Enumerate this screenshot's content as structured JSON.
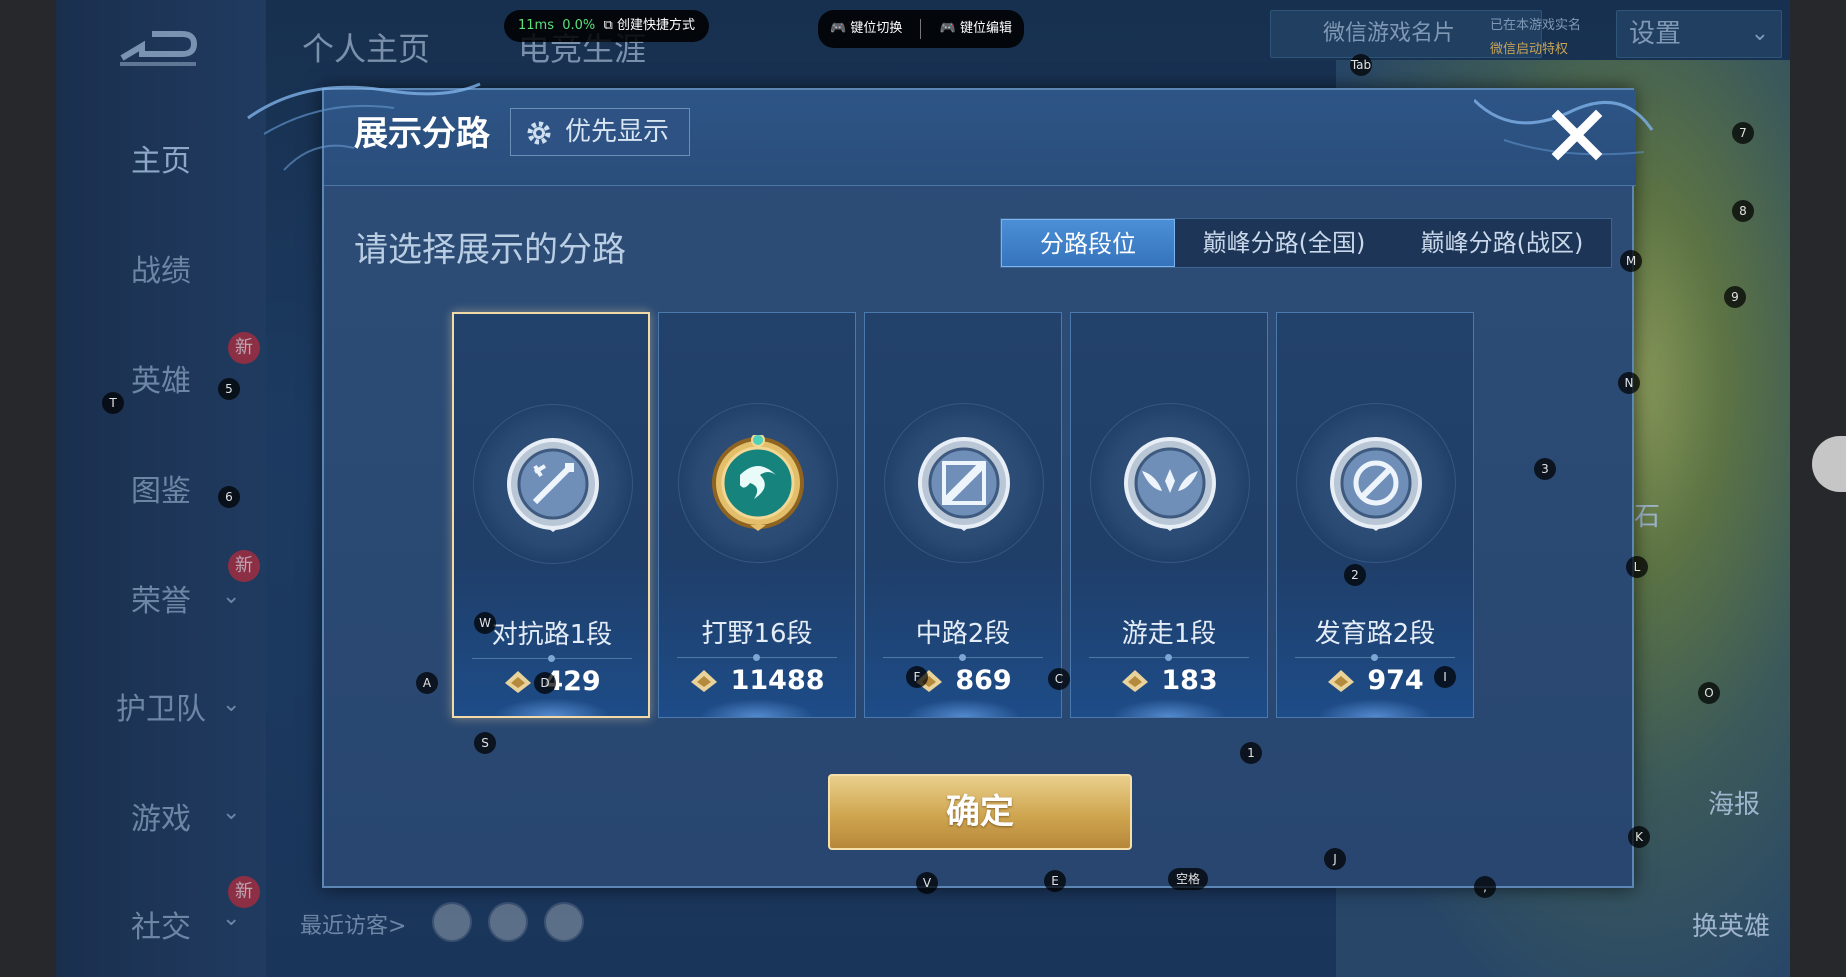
{
  "overlay": {
    "latency": "11ms",
    "loss": "0.0%",
    "create_shortcut": "创建快捷方式",
    "key_switch": "键位切换",
    "key_edit": "键位编辑",
    "keys": {
      "tab": "Tab",
      "n7": "7",
      "n8": "8",
      "m": "M",
      "n9": "9",
      "n": "N",
      "n3": "3",
      "l": "L",
      "o": "O",
      "k": "K",
      "j": "J",
      "comma": ",",
      "space": "空格",
      "e": "E",
      "v": "V",
      "s": "S",
      "n1": "1",
      "i": "I",
      "c": "C",
      "f": "F",
      "a": "A",
      "d": "D",
      "w": "W",
      "n2": "2",
      "n5": "5",
      "n6": "6",
      "t": "T"
    }
  },
  "background": {
    "tabs": [
      "个人主页",
      "电竞生涯"
    ],
    "sidebar": [
      "主页",
      "战绩",
      "英雄",
      "图鉴",
      "荣誉",
      "护卫队",
      "游戏",
      "社交"
    ],
    "new_badge": "新",
    "wechat_card": "微信游戏名片",
    "settings": "设置",
    "realname": "已在本游戏实名",
    "wechat_auth": "微信启动特权",
    "map_stone": "铭记之石",
    "poster": "海报",
    "switch_hero": "换英雄",
    "recent_visitors": "最近访客>"
  },
  "dialog": {
    "title": "展示分路",
    "priority_button": "优先显示",
    "subtitle": "请选择展示的分路",
    "tabs": [
      "分路段位",
      "巅峰分路(全国)",
      "巅峰分路(战区)"
    ],
    "active_tab": 0,
    "cards": [
      {
        "name": "对抗路1段",
        "score": "429",
        "selected": true,
        "emblem": "sword-emblem-icon"
      },
      {
        "name": "打野16段",
        "score": "11488",
        "selected": false,
        "emblem": "dragon-emblem-icon"
      },
      {
        "name": "中路2段",
        "score": "869",
        "selected": false,
        "emblem": "slash-emblem-icon"
      },
      {
        "name": "游走1段",
        "score": "183",
        "selected": false,
        "emblem": "wings-emblem-icon"
      },
      {
        "name": "发育路2段",
        "score": "974",
        "selected": false,
        "emblem": "shield-emblem-icon"
      }
    ],
    "confirm_button": "确定"
  },
  "colors": {
    "accent_blue": "#3574bc",
    "gold": "#cfa650",
    "selected_border": "#f1d9a8"
  }
}
